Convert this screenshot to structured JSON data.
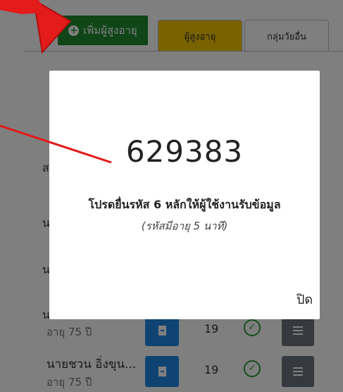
{
  "toolbar": {
    "add_button_label": "เพิ่มผู้สูงอายุ",
    "tabs": [
      {
        "label": "ผู้สูงอายุ"
      },
      {
        "label": "กลุ่มวัยอื่น"
      }
    ]
  },
  "list": {
    "fragments": [
      "ส",
      "น",
      "น",
      "น"
    ],
    "rows": [
      {
        "name": "",
        "age": "อายุ 75 ปี",
        "count": "19"
      },
      {
        "name": "นายชวน อิ่งขุน...",
        "age": "อายุ 75 ปี",
        "count": "19"
      }
    ]
  },
  "modal": {
    "code": "629383",
    "message": "โปรดยื่นรหัส 6 หลักให้ผู้ใช้งานรับข้อมูล",
    "note": "(รหัสมีอายุ 5 นาที)",
    "close_label": "ปิด"
  },
  "colors": {
    "add_button": "#1e8a2e",
    "active_tab": "#f3c400",
    "doc_button": "#1e88e5",
    "menu_button": "#6c757d",
    "annotation_arrow": "#e31b1b"
  }
}
